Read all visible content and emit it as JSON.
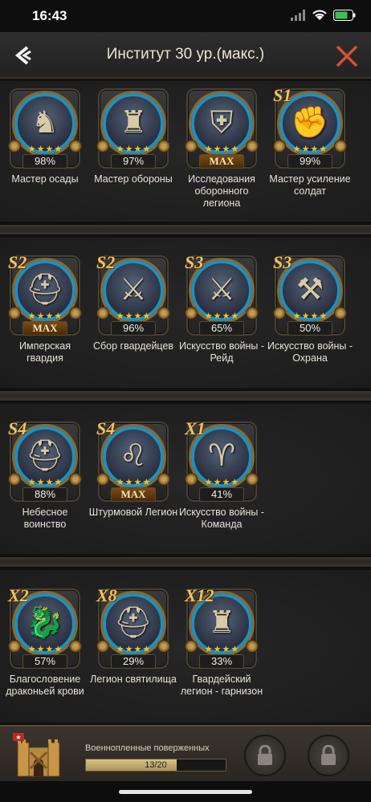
{
  "status_bar": {
    "time": "16:43"
  },
  "header": {
    "title": "Институт 30 ур.(макс.)"
  },
  "cards": [
    {
      "name": "Мастер осады",
      "tier": "",
      "progress": "98%",
      "progress_value": 98,
      "stars": 4,
      "emblem": "knight-chess-icon"
    },
    {
      "name": "Мастер обороны",
      "tier": "",
      "progress": "97%",
      "progress_value": 97,
      "stars": 4,
      "emblem": "castle-tower-icon"
    },
    {
      "name": "Исследования оборонного легиона",
      "tier": "",
      "progress": "MAX",
      "progress_value": 100,
      "stars": 4,
      "emblem": "shield-crest-icon"
    },
    {
      "name": "Мастер усиление солдат",
      "tier": "S1",
      "progress": "99%",
      "progress_value": 99,
      "stars": 4,
      "emblem": "gauntlet-icon"
    },
    {
      "name": "Имперская гвардия",
      "tier": "S2",
      "progress": "MAX",
      "progress_value": 100,
      "stars": 4,
      "emblem": "knight-helmet-icon"
    },
    {
      "name": "Сбор гвардейцев",
      "tier": "S2",
      "progress": "96%",
      "progress_value": 96,
      "stars": 4,
      "emblem": "crossed-swords-helmet-icon"
    },
    {
      "name": "Искусство войны - Рейд",
      "tier": "S3",
      "progress": "65%",
      "progress_value": 65,
      "stars": 4,
      "emblem": "crossed-swords-icon"
    },
    {
      "name": "Искусство войны - Охрана",
      "tier": "S3",
      "progress": "50%",
      "progress_value": 50,
      "stars": 4,
      "emblem": "crossed-axes-icon"
    },
    {
      "name": "Небесное воинство",
      "tier": "S4",
      "progress": "88%",
      "progress_value": 88,
      "stars": 4,
      "emblem": "great-helm-icon"
    },
    {
      "name": "Штурмовой Легион",
      "tier": "S4",
      "progress": "MAX",
      "progress_value": 100,
      "stars": 4,
      "emblem": "lion-head-icon"
    },
    {
      "name": "Искусство войны - Команда",
      "tier": "X1",
      "progress": "41%",
      "progress_value": 41,
      "stars": 4,
      "emblem": "war-horns-icon"
    },
    {
      "name": "Благословение драконьей крови",
      "tier": "X2",
      "progress": "57%",
      "progress_value": 57,
      "stars": 4,
      "emblem": "dragon-head-icon"
    },
    {
      "name": "Легион святилища",
      "tier": "X8",
      "progress": "29%",
      "progress_value": 29,
      "stars": 4,
      "emblem": "plumed-helmet-icon"
    },
    {
      "name": "Гвардейский легион - гарнизон",
      "tier": "X12",
      "progress": "33%",
      "progress_value": 33,
      "stars": 4,
      "emblem": "golden-castle-icon"
    }
  ],
  "bottom": {
    "label": "Военнопленные поверженных",
    "progress_text": "13/20",
    "progress_value": 0.65
  },
  "colors": {
    "ring": "#1f8fc0",
    "gold": "#f5c21b",
    "close": "#d4503a"
  }
}
